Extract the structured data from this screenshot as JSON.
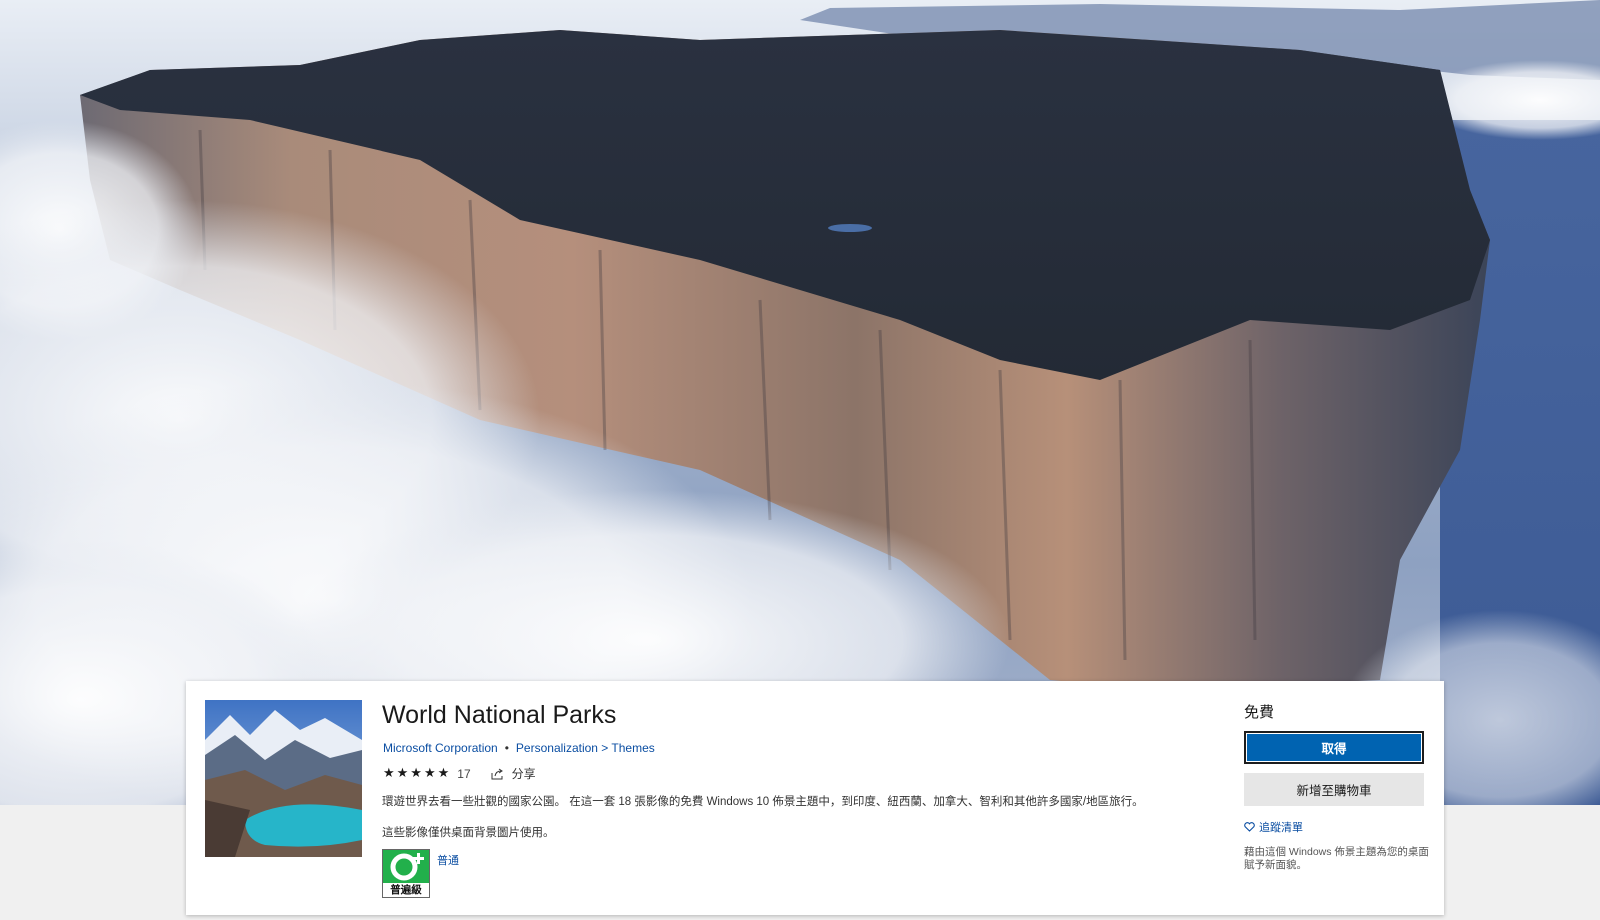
{
  "app": {
    "title": "World National Parks",
    "publisher": "Microsoft Corporation",
    "separator": "•",
    "category_path": "Personalization > Themes",
    "rating_stars": "★★★★★",
    "rating_count": "17",
    "share_label": "分享",
    "description": "環遊世界去看一些壯觀的國家公園。 在這一套 18 張影像的免費 Windows 10 佈景主題中，到印度、紐西蘭、加拿大、智利和其他許多國家/地區旅行。",
    "usage_note": "這些影像僅供桌面背景圖片使用。",
    "age_rating_badge": "普遍級",
    "age_rating_text": "普通"
  },
  "purchase": {
    "price": "免費",
    "get_button": "取得",
    "add_to_cart_button": "新增至購物車",
    "wishlist_label": "追蹤清單",
    "side_note": "藉由這個 Windows 佈景主題為您的桌面賦予新面貌。"
  },
  "colors": {
    "accent": "#0063b1",
    "link": "#0b4ea2",
    "age_badge_green": "#22b04b"
  }
}
